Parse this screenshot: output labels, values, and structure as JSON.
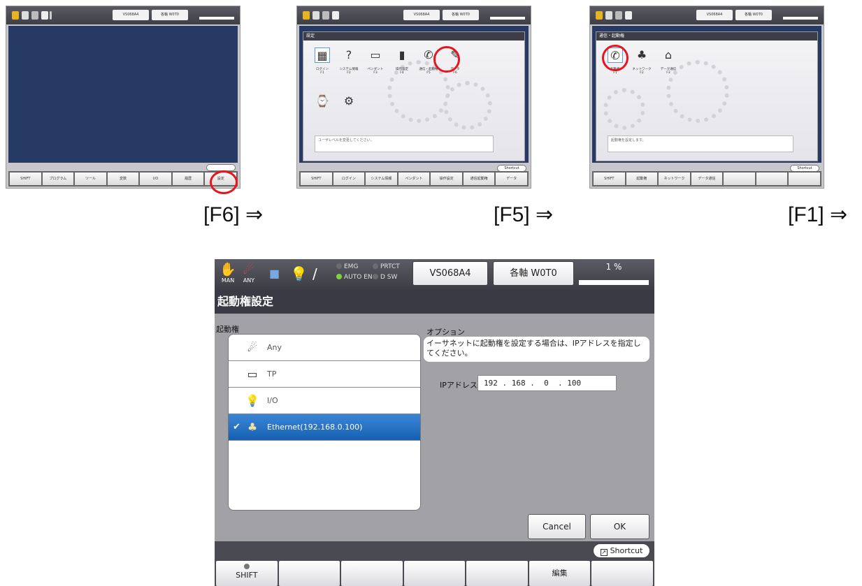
{
  "steps": {
    "s1": "[F6] ⇒",
    "s2": "[F5] ⇒",
    "s3": "[F1] ⇒"
  },
  "status": {
    "mode1": "MAN",
    "mode2": "ANY",
    "emg": "EMG",
    "prtct": "PRTCT",
    "auto_en": "AUTO EN",
    "dsw": "D SW",
    "robot_type": "VS068A4",
    "axis": "各軸 W0T0",
    "speed": "1 %"
  },
  "title": "起動権設定",
  "left": {
    "label": "起動権",
    "items": [
      {
        "icon": "any-icon",
        "label": "Any"
      },
      {
        "icon": "pendant-icon",
        "label": "TP"
      },
      {
        "icon": "bulb-icon",
        "label": "I/O"
      },
      {
        "icon": "network-icon",
        "label": "Ethernet(192.168.0.100)",
        "selected": true
      }
    ]
  },
  "right": {
    "label": "オプション",
    "message": "イーサネットに起動権を設定する場合は、IPアドレスを指定してください。",
    "ip_label": "IPアドレス",
    "ip_value": "192 . 168 .  0  . 100"
  },
  "buttons": {
    "cancel": "Cancel",
    "ok": "OK"
  },
  "shortcut": "Shortcut",
  "fkeys": [
    "SHIFT",
    "",
    "",
    "",
    "",
    "編集",
    ""
  ],
  "colors": {
    "selected": "#1f6fc4",
    "title_bar": "#3a3a44",
    "highlight_circle": "#e8141e"
  }
}
